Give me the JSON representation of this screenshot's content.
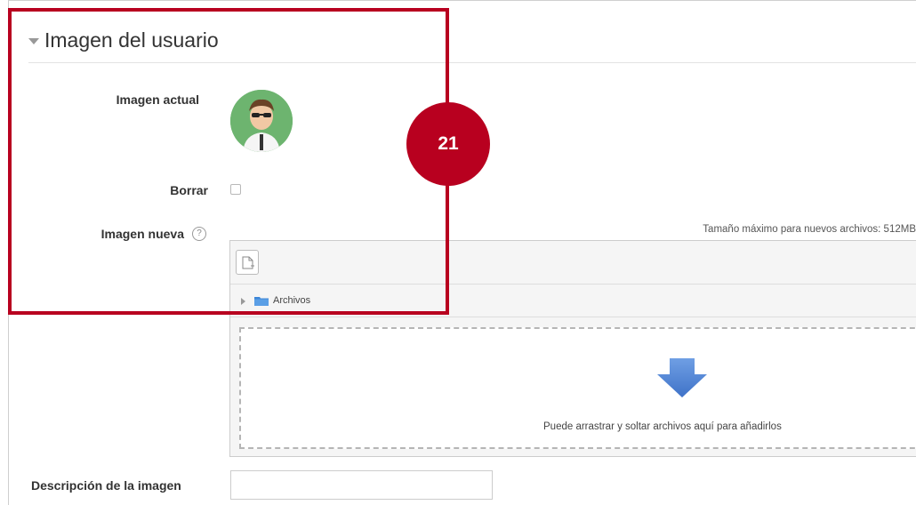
{
  "section": {
    "title": "Imagen del usuario"
  },
  "fields": {
    "current_image_label": "Imagen actual",
    "delete_label": "Borrar",
    "new_image_label": "Imagen nueva",
    "description_label": "Descripción de la imagen"
  },
  "filepicker": {
    "max_size_text": "Tamaño máximo para nuevos archivos: 512MB",
    "folder_label": "Archivos",
    "drop_text": "Puede arrastrar y soltar archivos aquí para añadirlos"
  },
  "annotation": {
    "badge_number": "21",
    "color": "#b8001f"
  },
  "icons": [
    "collapse-arrow-icon",
    "help-icon",
    "add-file-icon",
    "expand-triangle-icon",
    "folder-icon",
    "down-arrow-icon"
  ],
  "colors": {
    "avatar_bg": "#6db46f",
    "arrow_blue": "#4a7fd1"
  }
}
